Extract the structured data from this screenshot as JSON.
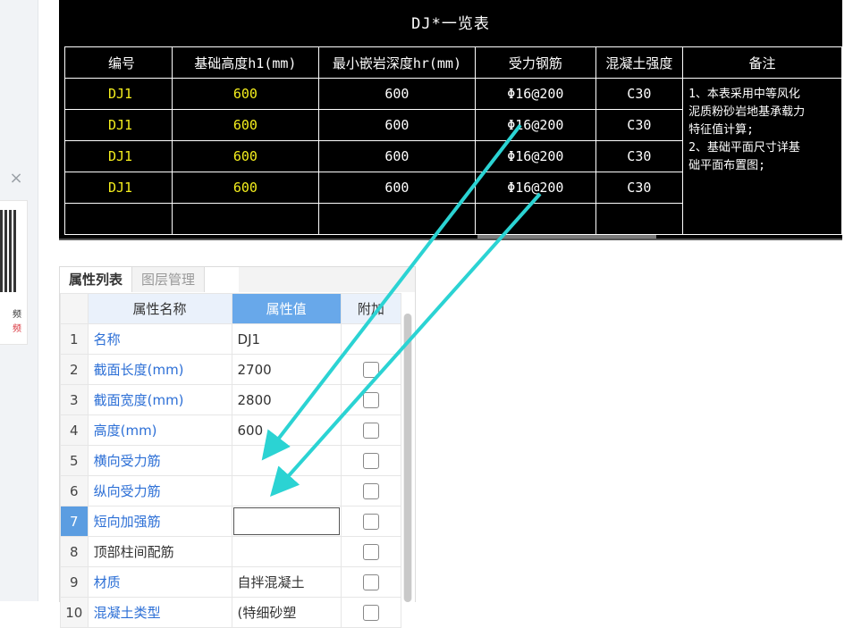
{
  "side": {
    "close_glyph": "×",
    "qr_text1": "频",
    "qr_text2": "频"
  },
  "cad": {
    "title": "DJ*一览表",
    "headers": [
      "编号",
      "基础高度h1(mm)",
      "最小嵌岩深度hr(mm)",
      "受力钢筋",
      "混凝土强度",
      "备注"
    ],
    "rows": [
      [
        "DJ1",
        "600",
        "600",
        "Φ16@200",
        "C30"
      ],
      [
        "DJ1",
        "600",
        "600",
        "Φ16@200",
        "C30"
      ],
      [
        "DJ1",
        "600",
        "600",
        "Φ16@200",
        "C30"
      ],
      [
        "DJ1",
        "600",
        "600",
        "Φ16@200",
        "C30"
      ]
    ],
    "note": "1、本表采用中等风化\n泥质粉砂岩地基承载力\n特征值计算;\n2、基础平面尺寸详基\n础平面布置图;"
  },
  "panel": {
    "tabs": [
      "属性列表",
      "图层管理"
    ],
    "active_tab": 0,
    "columns": [
      "属性名称",
      "属性值",
      "附加"
    ],
    "rows": [
      {
        "idx": "1",
        "name": "名称",
        "value": "DJ1",
        "name_color": "blue",
        "has_check": false
      },
      {
        "idx": "2",
        "name": "截面长度(mm)",
        "value": "2700",
        "name_color": "blue",
        "has_check": true
      },
      {
        "idx": "3",
        "name": "截面宽度(mm)",
        "value": "2800",
        "name_color": "blue",
        "has_check": true
      },
      {
        "idx": "4",
        "name": "高度(mm)",
        "value": "600",
        "name_color": "blue",
        "has_check": true
      },
      {
        "idx": "5",
        "name": "横向受力筋",
        "value": "",
        "name_color": "blue",
        "has_check": true
      },
      {
        "idx": "6",
        "name": "纵向受力筋",
        "value": "",
        "name_color": "blue",
        "has_check": true
      },
      {
        "idx": "7",
        "name": "短向加强筋",
        "value": "",
        "name_color": "blue",
        "has_check": true,
        "selected": true
      },
      {
        "idx": "8",
        "name": "顶部柱间配筋",
        "value": "",
        "name_color": "black",
        "has_check": true
      },
      {
        "idx": "9",
        "name": "材质",
        "value": "自拌混凝土",
        "name_color": "blue",
        "has_check": true
      },
      {
        "idx": "10",
        "name": "混凝土类型",
        "value": "(特细砂塑",
        "name_color": "blue",
        "has_check": true
      }
    ]
  },
  "annotation": {
    "arrow_color": "#2bd3d3"
  }
}
